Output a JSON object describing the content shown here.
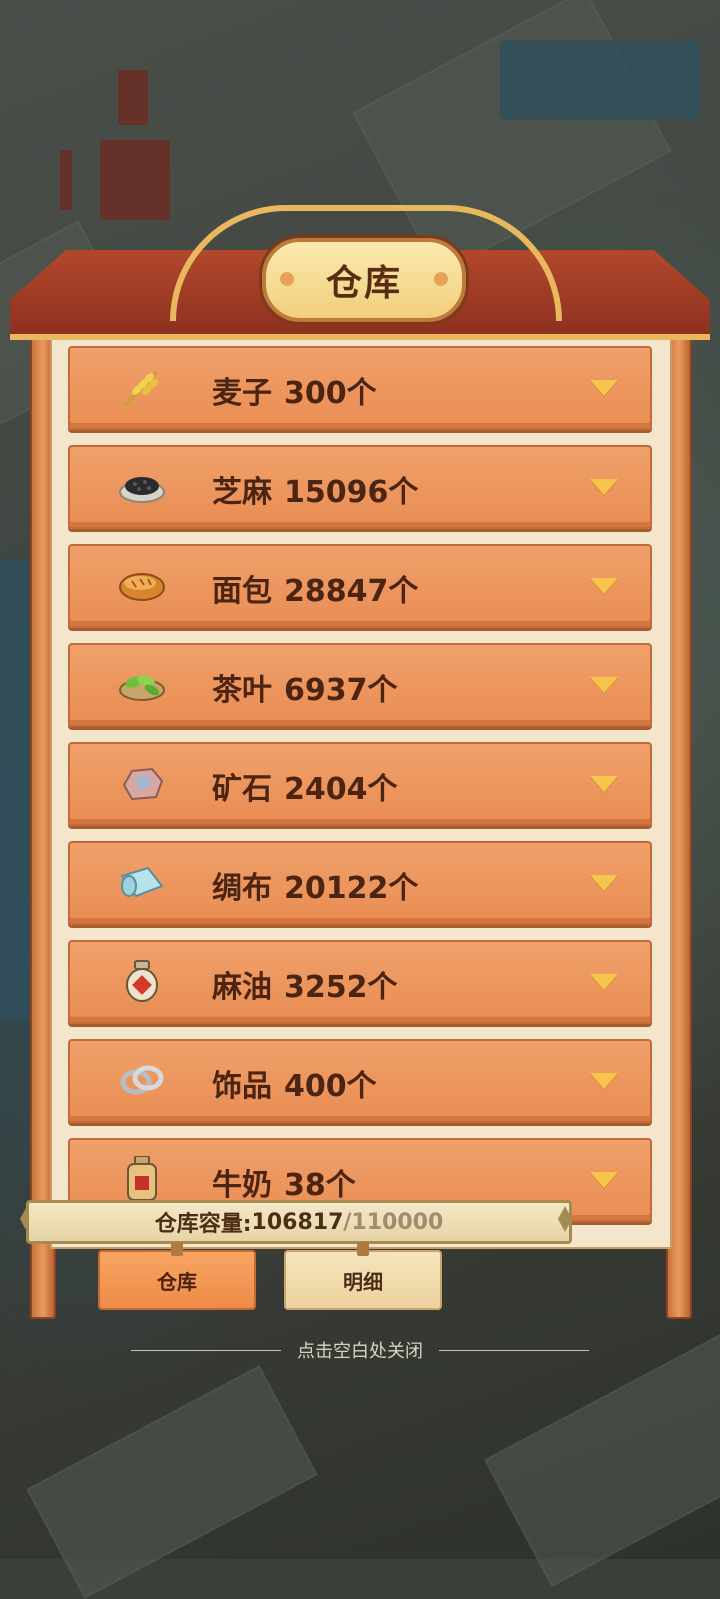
{
  "window": {
    "title": "仓库"
  },
  "items": [
    {
      "name": "麦子",
      "count": "300个",
      "icon": "wheat-icon"
    },
    {
      "name": "芝麻",
      "count": "15096个",
      "icon": "sesame-icon"
    },
    {
      "name": "面包",
      "count": "28847个",
      "icon": "bread-icon"
    },
    {
      "name": "茶叶",
      "count": "6937个",
      "icon": "tea-leaves-icon"
    },
    {
      "name": "矿石",
      "count": "2404个",
      "icon": "ore-icon"
    },
    {
      "name": "绸布",
      "count": "20122个",
      "icon": "silk-cloth-icon"
    },
    {
      "name": "麻油",
      "count": "3252个",
      "icon": "sesame-oil-jar-icon"
    },
    {
      "name": "饰品",
      "count": "400个",
      "icon": "rings-icon"
    },
    {
      "name": "牛奶",
      "count": "38个",
      "icon": "milk-can-icon"
    }
  ],
  "capacity": {
    "label": "仓库容量:",
    "current": "106817",
    "max": "/110000"
  },
  "tabs": [
    {
      "label": "仓库",
      "active": true
    },
    {
      "label": "明细",
      "active": false
    }
  ],
  "close_hint": "点击空白处关闭",
  "colors": {
    "item_bg": "#ed955d",
    "chevron": "#f7c54c",
    "title_plaque": "#f4d889",
    "text": "#4b2512"
  }
}
